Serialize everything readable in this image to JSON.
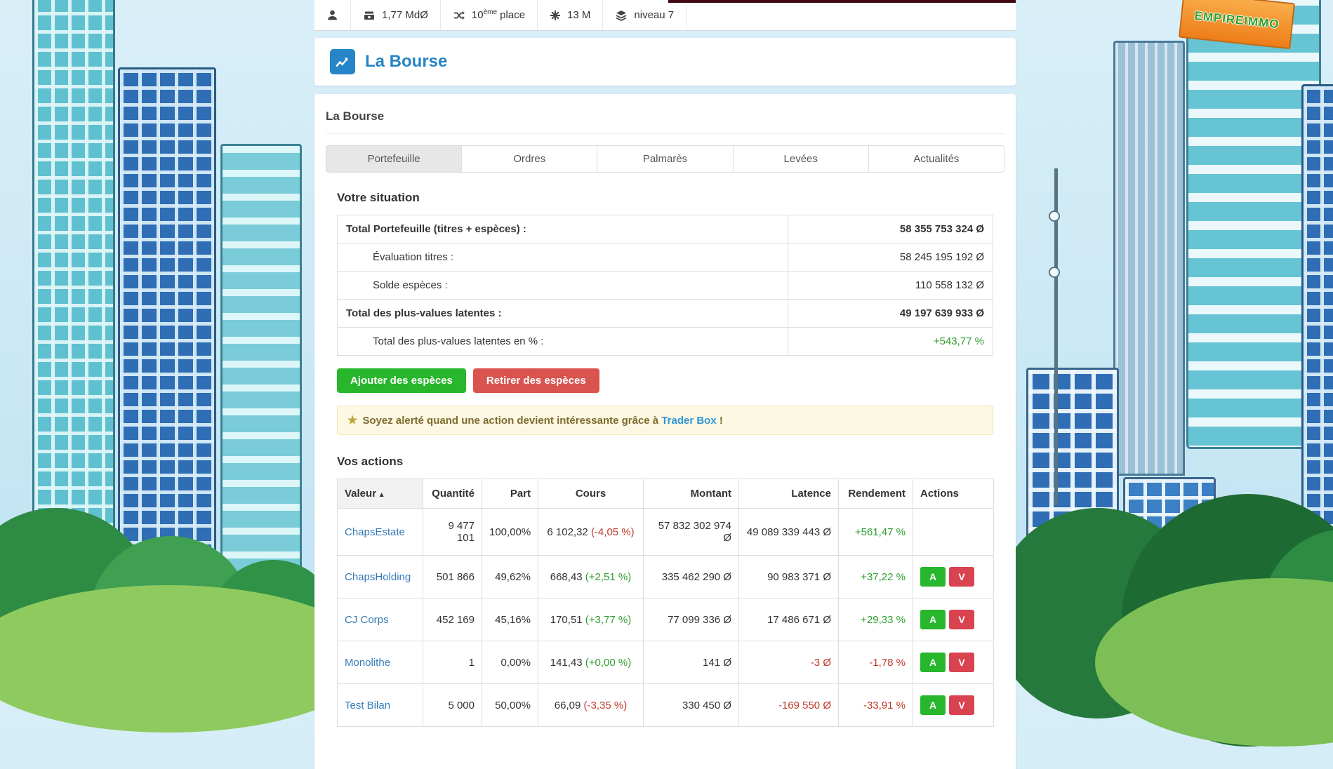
{
  "background": {
    "sign_text": "EMPIREIMMO"
  },
  "topbar": {
    "money": "1,77 MdØ",
    "rank_number": "10",
    "rank_sup": "ème",
    "rank_suffix": " place",
    "points": "13 M",
    "level": "niveau 7"
  },
  "header": {
    "title": "La Bourse"
  },
  "panel": {
    "title": "La Bourse",
    "tabs": [
      {
        "label": "Portefeuille",
        "active": true
      },
      {
        "label": "Ordres",
        "active": false
      },
      {
        "label": "Palmarès",
        "active": false
      },
      {
        "label": "Levées",
        "active": false
      },
      {
        "label": "Actualités",
        "active": false
      }
    ]
  },
  "situation": {
    "heading": "Votre situation",
    "rows": [
      {
        "label": "Total Portefeuille (titres + espèces) :",
        "value": "58 355 753 324 Ø",
        "bold": true,
        "indent": false,
        "value_class": ""
      },
      {
        "label": "Évaluation titres :",
        "value": "58 245 195 192 Ø",
        "bold": false,
        "indent": true,
        "value_class": ""
      },
      {
        "label": "Solde espèces :",
        "value": "110 558 132 Ø",
        "bold": false,
        "indent": true,
        "value_class": ""
      },
      {
        "label": "Total des plus-values latentes :",
        "value": "49 197 639 933 Ø",
        "bold": true,
        "indent": false,
        "value_class": ""
      },
      {
        "label": "Total des plus-values latentes en % :",
        "value": "+543,77 %",
        "bold": false,
        "indent": true,
        "value_class": "pos"
      }
    ],
    "buttons": {
      "add": "Ajouter des espèces",
      "withdraw": "Retirer des espèces"
    }
  },
  "alert": {
    "star": "★",
    "text_before": "Soyez alerté quand une action devient intéressante grâce à ",
    "link_text": "Trader Box",
    "text_after": " !"
  },
  "stocks": {
    "heading": "Vos actions",
    "columns": [
      "Valeur",
      "Quantité",
      "Part",
      "Cours",
      "Montant",
      "Latence",
      "Rendement",
      "Actions"
    ],
    "sort_caret": "▲",
    "buy_label": "A",
    "sell_label": "V",
    "rows": [
      {
        "name": "ChapsEstate",
        "quantity": "9 477 101",
        "part": "100,00%",
        "price": "6 102,32",
        "variation": "(-4,05 %)",
        "variation_class": "neg",
        "amount": "57 832 302 974 Ø",
        "latency": "49 089 339 443 Ø",
        "latency_class": "",
        "yield": "+561,47 %",
        "yield_class": "pos",
        "has_buttons": false
      },
      {
        "name": "ChapsHolding",
        "quantity": "501 866",
        "part": "49,62%",
        "price": "668,43",
        "variation": "(+2,51 %)",
        "variation_class": "pos",
        "amount": "335 462 290 Ø",
        "latency": "90 983 371 Ø",
        "latency_class": "",
        "yield": "+37,22 %",
        "yield_class": "pos",
        "has_buttons": true
      },
      {
        "name": "CJ Corps",
        "quantity": "452 169",
        "part": "45,16%",
        "price": "170,51",
        "variation": "(+3,77 %)",
        "variation_class": "pos",
        "amount": "77 099 336 Ø",
        "latency": "17 486 671 Ø",
        "latency_class": "",
        "yield": "+29,33 %",
        "yield_class": "pos",
        "has_buttons": true
      },
      {
        "name": "Monolithe",
        "quantity": "1",
        "part": "0,00%",
        "price": "141,43",
        "variation": "(+0,00 %)",
        "variation_class": "pos",
        "amount": "141 Ø",
        "latency": "-3 Ø",
        "latency_class": "neg",
        "yield": "-1,78 %",
        "yield_class": "neg",
        "has_buttons": true
      },
      {
        "name": "Test Bilan",
        "quantity": "5 000",
        "part": "50,00%",
        "price": "66,09",
        "variation": "(-3,35 %)",
        "variation_class": "neg",
        "amount": "330 450 Ø",
        "latency": "-169 550 Ø",
        "latency_class": "neg",
        "yield": "-33,91 %",
        "yield_class": "neg",
        "has_buttons": true
      }
    ]
  },
  "colors": {
    "accent_blue": "#2585c7",
    "link_blue": "#337ab7",
    "positive_green": "#2e9e2e",
    "negative_red": "#c0392b",
    "button_green": "#28b62c",
    "button_red": "#d9534f"
  }
}
